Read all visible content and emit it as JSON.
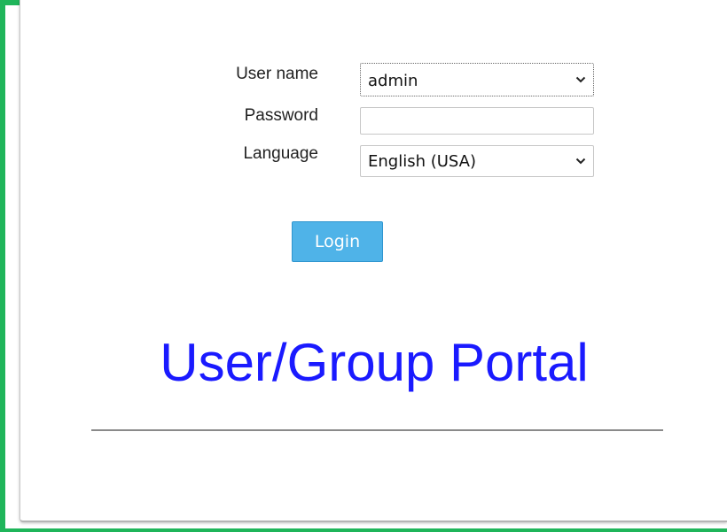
{
  "login_form": {
    "username_label": "User name",
    "username_value": "admin",
    "password_label": "Password",
    "password_value": "",
    "language_label": "Language",
    "language_value": "English (USA)",
    "login_label": "Login",
    "dropdown_icon": "chevron-down-icon"
  },
  "branding": {
    "title": "User/Group Portal"
  },
  "colors": {
    "frame_border": "#1fb55a",
    "title": "#1a1aff",
    "login_button": "#4fb3e8"
  }
}
